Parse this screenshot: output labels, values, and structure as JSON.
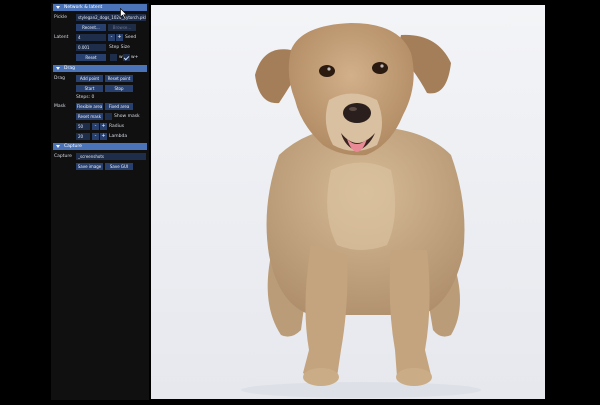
{
  "sections": {
    "network": "Network & latent",
    "drag": "Drag",
    "capture": "Capture"
  },
  "network": {
    "pickle_label": "Pickle",
    "pickle_value": "stylegan2_dogs_1024_pytorch.pkl",
    "recent_button": "Recent...",
    "browse_button": "Browse...",
    "latent_label": "Latent",
    "latent_value": "4",
    "seed_label": "Seed",
    "step_value": "0.001",
    "step_label": "Step Size",
    "reset_button": "Reset",
    "w_label": "w",
    "wplus_label": "w+"
  },
  "drag": {
    "drag_label": "Drag",
    "add_point_button": "Add point",
    "reset_point_button": "Reset point",
    "start_button": "Start",
    "stop_button": "Stop",
    "steps_text": "Steps: 0",
    "mask_label": "Mask",
    "flexible_area_button": "Flexible area",
    "fixed_area_button": "Fixed area",
    "reset_mask_button": "Reset mask",
    "show_mask_label": "Show mask",
    "radius_value": "50",
    "radius_label": "Radius",
    "lambda_value": "20",
    "lambda_label": "Lambda"
  },
  "capture": {
    "capture_label": "Capture",
    "path_value": "_screenshots",
    "save_image_button": "Save image",
    "save_gui_button": "Save GUI"
  },
  "colors": {
    "header": "#4a73b8",
    "button": "#28406e",
    "field": "#1e2d4a",
    "panel": "#101010"
  }
}
